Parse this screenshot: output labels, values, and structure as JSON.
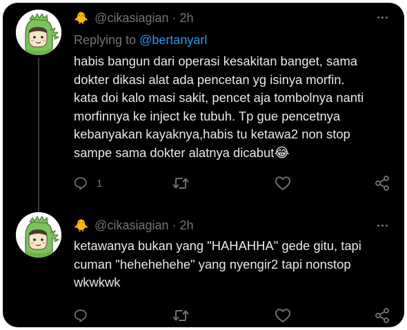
{
  "tweets": [
    {
      "emoji": "🐥",
      "username": "@cikasiagian",
      "separator": "·",
      "time": "2h",
      "replying_prefix": "Replying to",
      "replying_handle": "@bertanyarl",
      "text": "habis bangun dari operasi kesakitan banget, sama\ndokter dikasi alat ada pencetan yg isinya morfin.\nkata doi kalo masi sakit, pencet aja tombolnya nanti\nmorfinnya ke inject ke tubuh. Tp gue pencetnya\nkebanyakan kayaknya,habis tu ketawa2 non stop\nsampe sama dokter alatnya dicabut",
      "text_emoji": "😂",
      "reply_count": "1",
      "avatar_icon": "green-dinosaur-avatar",
      "actions": [
        "reply-icon",
        "retweet-icon",
        "like-icon",
        "share-icon"
      ]
    },
    {
      "emoji": "🐥",
      "username": "@cikasiagian",
      "separator": "·",
      "time": "2h",
      "text": "ketawanya bukan yang \"HAHAHHA\" gede gitu, tapi\ncuman \"hehehehehe\" yang nyengir2 tapi nonstop\nwkwkwk",
      "avatar_icon": "green-dinosaur-avatar",
      "actions": [
        "reply-icon",
        "retweet-icon",
        "like-icon",
        "share-icon"
      ]
    }
  ],
  "colors": {
    "background": "#000000",
    "text": "#e7e9ea",
    "secondary": "#6e767d",
    "link": "#1d9bf0",
    "avatar_green": "#7cc45a"
  }
}
